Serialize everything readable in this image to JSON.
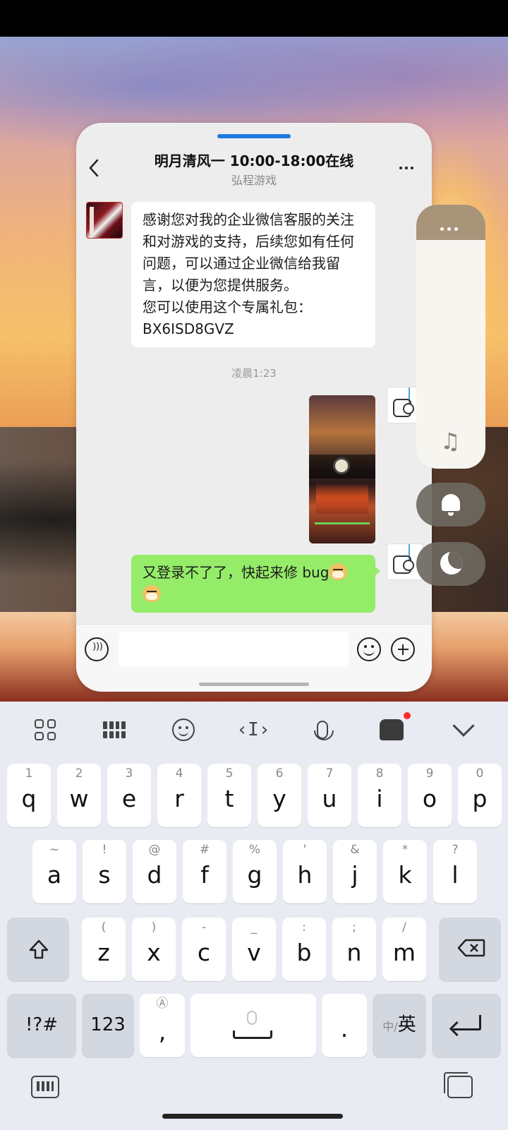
{
  "chat": {
    "title": "明月清风一 10:00-18:00在线",
    "subtitle": "弘程游戏",
    "incoming_lines": [
      "感谢您对我的企业微信客服的关注",
      "和对游戏的支持，后续您如有任何",
      "问题，可以通过企业微信给我留",
      "言，以便为您提供服务。",
      "您可以使用这个专属礼包：",
      "BX6ISD8GVZ"
    ],
    "timestamp": "凌晨1:23",
    "outgoing_text": "又登录不了了，快起来修 bug",
    "input_placeholder": ""
  },
  "icons": {
    "back": "chevron-left-icon",
    "more": "more-dots-icon",
    "voice": "voice-icon",
    "emoji": "emoji-icon",
    "plus": "plus-icon",
    "music": "music-note-icon",
    "bell": "bell-icon",
    "moon": "moon-icon"
  },
  "keyboard": {
    "row1": [
      {
        "sub": "1",
        "main": "q"
      },
      {
        "sub": "2",
        "main": "w"
      },
      {
        "sub": "3",
        "main": "e"
      },
      {
        "sub": "4",
        "main": "r"
      },
      {
        "sub": "5",
        "main": "t"
      },
      {
        "sub": "6",
        "main": "y"
      },
      {
        "sub": "7",
        "main": "u"
      },
      {
        "sub": "8",
        "main": "i"
      },
      {
        "sub": "9",
        "main": "o"
      },
      {
        "sub": "0",
        "main": "p"
      }
    ],
    "row2": [
      {
        "sub": "~",
        "main": "a"
      },
      {
        "sub": "!",
        "main": "s"
      },
      {
        "sub": "@",
        "main": "d"
      },
      {
        "sub": "#",
        "main": "f"
      },
      {
        "sub": "%",
        "main": "g"
      },
      {
        "sub": "'",
        "main": "h"
      },
      {
        "sub": "&",
        "main": "j"
      },
      {
        "sub": "*",
        "main": "k"
      },
      {
        "sub": "?",
        "main": "l"
      }
    ],
    "row3": [
      {
        "sub": "(",
        "main": "z"
      },
      {
        "sub": ")",
        "main": "x"
      },
      {
        "sub": "-",
        "main": "c"
      },
      {
        "sub": "_",
        "main": "v"
      },
      {
        "sub": ":",
        "main": "b"
      },
      {
        "sub": ";",
        "main": "n"
      },
      {
        "sub": "/",
        "main": "m"
      }
    ],
    "symbols_label": "!?#",
    "numbers_label": "123",
    "comma_label": ",",
    "period_label": ".",
    "lang_sub": "中/",
    "lang_main": "英"
  },
  "colors": {
    "outgoing_bubble": "#95ec69",
    "handle": "#1f7ae0",
    "notification_dot": "#ff2b2b"
  }
}
